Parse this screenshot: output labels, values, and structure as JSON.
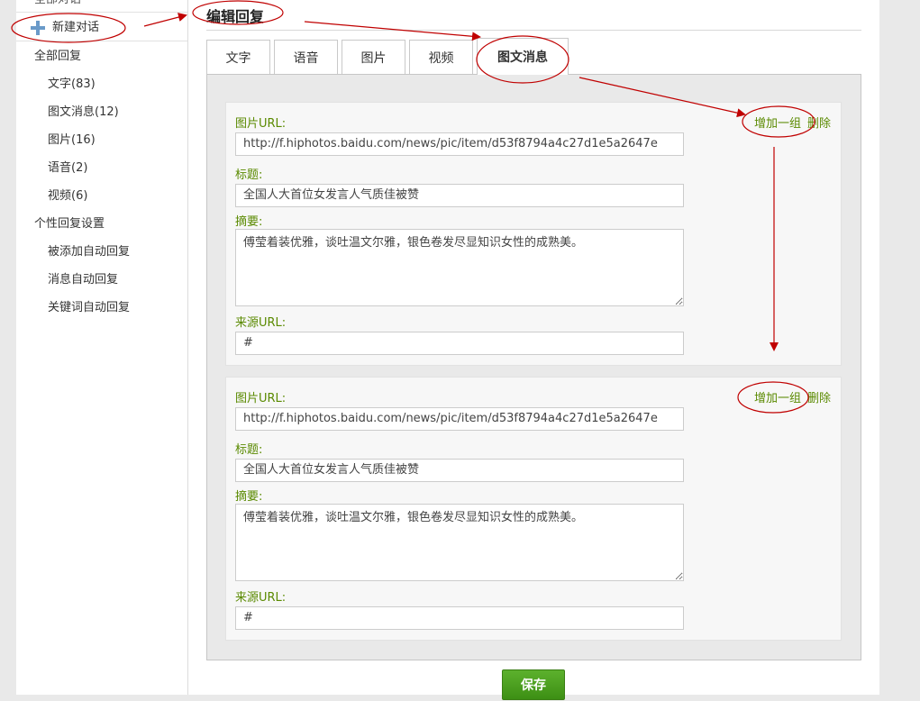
{
  "sidebar": {
    "top_cut": "全部对话",
    "new_chat": "新建对话",
    "all_replies": "全部回复",
    "items": [
      {
        "label": "文字(83)"
      },
      {
        "label": "图文消息(12)"
      },
      {
        "label": "图片(16)"
      },
      {
        "label": "语音(2)"
      },
      {
        "label": "视频(6)"
      }
    ],
    "custom_settings": "个性回复设置",
    "sub_items": [
      {
        "label": "被添加自动回复"
      },
      {
        "label": "消息自动回复"
      },
      {
        "label": "关键词自动回复"
      }
    ]
  },
  "main": {
    "title": "编辑回复",
    "tabs": [
      {
        "label": "文字"
      },
      {
        "label": "语音"
      },
      {
        "label": "图片"
      },
      {
        "label": "视频"
      },
      {
        "label": "图文消息"
      }
    ],
    "active_tab": "图文消息",
    "groups": [
      {
        "image_url_label": "图片URL:",
        "image_url": "http://f.hiphotos.baidu.com/news/pic/item/d53f8794a4c27d1e5a2647e",
        "title_label": "标题:",
        "title_value": "全国人大首位女发言人气质佳被赞",
        "summary_label": "摘要:",
        "summary_value": "傅莹着装优雅，谈吐温文尔雅，银色卷发尽显知识女性的成熟美。",
        "source_url_label": "来源URL:",
        "source_url": "#",
        "add_label": "增加一组",
        "delete_label": "删除"
      },
      {
        "image_url_label": "图片URL:",
        "image_url": "http://f.hiphotos.baidu.com/news/pic/item/d53f8794a4c27d1e5a2647e",
        "title_label": "标题:",
        "title_value": "全国人大首位女发言人气质佳被赞",
        "summary_label": "摘要:",
        "summary_value": "傅莹着装优雅，谈吐温文尔雅，银色卷发尽显知识女性的成熟美。",
        "source_url_label": "来源URL:",
        "source_url": "#",
        "add_label": "增加一组",
        "delete_label": "删除"
      }
    ],
    "save_label": "保存"
  },
  "annotations": {
    "color": "#c00000"
  },
  "colors": {
    "accent_green": "#5a8a00",
    "save_button": "#4aa01f",
    "plus_icon": "#6a9ac9"
  }
}
